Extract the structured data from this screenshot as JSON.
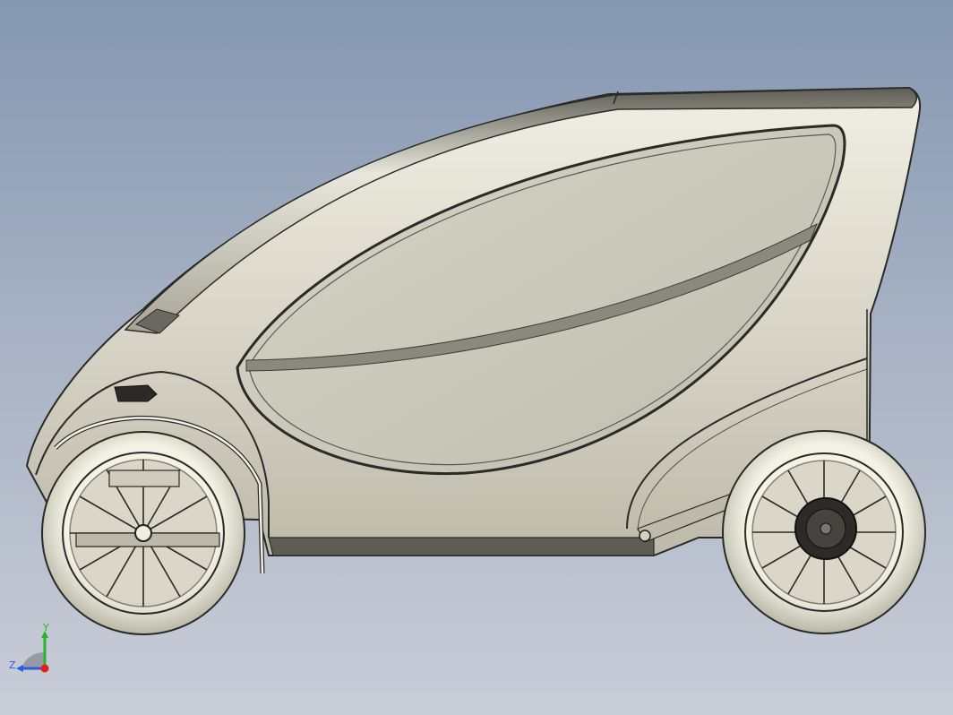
{
  "viewport": {
    "background_top": "#8597b1",
    "background_bottom": "#c9cdd8"
  },
  "model": {
    "body_color": "#d8d5c7",
    "glass_color": "#c9c7b9",
    "tire_color": "#f0eedd",
    "outline_color": "#222222"
  },
  "triad": {
    "y_label": "Y",
    "z_label": "Z",
    "x_color": "#e0201c",
    "y_color": "#2bb42b",
    "z_color": "#2b5ce0"
  }
}
